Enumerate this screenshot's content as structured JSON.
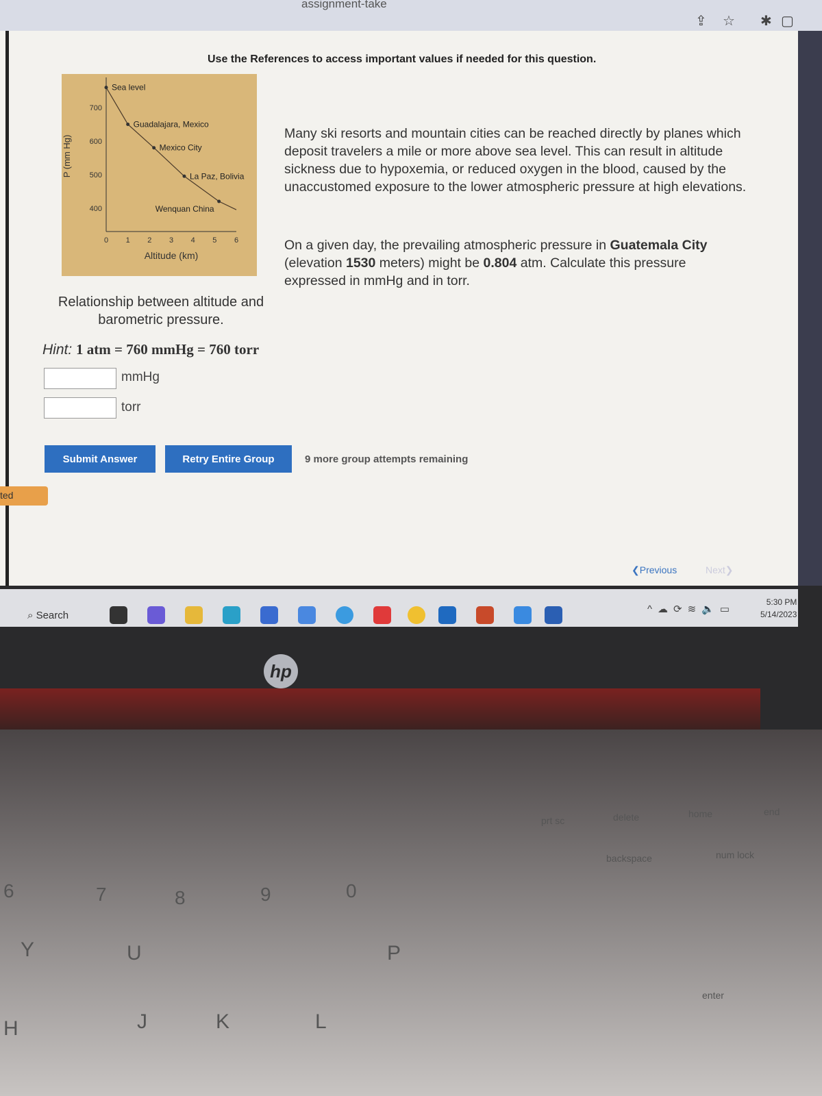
{
  "browser": {
    "url_fragment": "assignment-take"
  },
  "question": {
    "references_notice": "Use the References to access important values if needed for this question.",
    "paragraph1": "Many ski resorts and mountain cities can be reached directly by planes which deposit travelers a mile or more above sea level. This can result in altitude sickness due to hypoxemia, or reduced oxygen in the blood, caused by the unaccustomed exposure to the lower atmospheric pressure at high elevations.",
    "paragraph2_a": "On a given day, the prevailing atmospheric pressure in ",
    "paragraph2_city": "Guatemala City",
    "paragraph2_b": " (elevation ",
    "paragraph2_elev": "1530",
    "paragraph2_c": " meters) might be ",
    "paragraph2_atm": "0.804",
    "paragraph2_d": " atm. Calculate this pressure expressed in mmHg and in torr.",
    "caption": "Relationship between altitude and barometric pressure.",
    "hint_label": "Hint:",
    "hint_formula": "1 atm = 760 mmHg = 760 torr",
    "answers": [
      {
        "value": "",
        "unit": "mmHg"
      },
      {
        "value": "",
        "unit": "torr"
      }
    ],
    "submit_label": "Submit Answer",
    "retry_label": "Retry Entire Group",
    "attempts_text": "9 more group attempts remaining",
    "side_tab": "ted",
    "previous_label": "Previous",
    "next_label": "Next"
  },
  "chart_data": {
    "type": "line",
    "xlabel": "Altitude (km)",
    "ylabel": "P (mm Hg)",
    "xlim": [
      0,
      6
    ],
    "ylim": [
      330,
      790
    ],
    "xticks": [
      "0",
      "1",
      "2",
      "3",
      "4",
      "5",
      "6"
    ],
    "yticks": [
      "400",
      "500",
      "600",
      "700"
    ],
    "points": [
      {
        "label": "Sea level",
        "x": 0,
        "y": 760
      },
      {
        "label": "Guadalajara, Mexico",
        "x": 1.0,
        "y": 650
      },
      {
        "label": "Mexico City",
        "x": 2.2,
        "y": 580
      },
      {
        "label": "La Paz, Bolivia",
        "x": 3.6,
        "y": 495
      },
      {
        "label": "Wenquan China",
        "x": 5.2,
        "y": 420
      }
    ],
    "grid": false,
    "background": "#d9b779"
  },
  "taskbar": {
    "search_label": "Search",
    "time": "5:30 PM",
    "date": "5/14/2023"
  },
  "laptop": {
    "brand": "hp",
    "keys": [
      "prt sc",
      "delete",
      "home",
      "end",
      "backspace",
      "num lock",
      "enter",
      "8",
      "9",
      "0",
      "P",
      "U",
      "J",
      "K",
      "L",
      "Y",
      "H",
      "6",
      "7"
    ]
  }
}
